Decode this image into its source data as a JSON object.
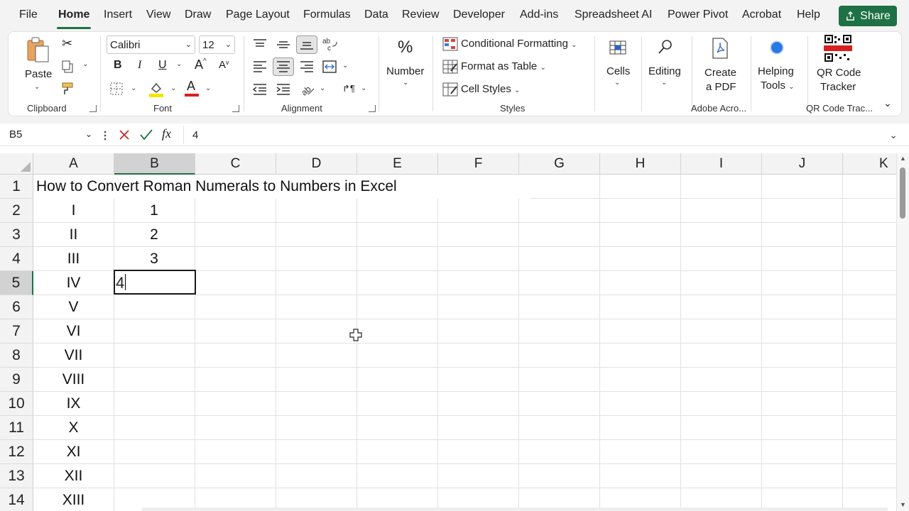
{
  "menu": {
    "items": [
      "File",
      "Home",
      "Insert",
      "View",
      "Draw",
      "Page Layout",
      "Formulas",
      "Data",
      "Review",
      "Developer",
      "Add-ins",
      "Spreadsheet AI",
      "Power Pivot",
      "Acrobat",
      "Help"
    ],
    "active": "Home",
    "share_label": "Share"
  },
  "ribbon": {
    "clipboard": {
      "paste_label": "Paste",
      "group_label": "Clipboard"
    },
    "font": {
      "font_name": "Calibri",
      "font_size": "12",
      "bold": "B",
      "italic": "I",
      "underline": "U",
      "grow": "A",
      "shrink": "A",
      "font_color_letter": "A",
      "group_label": "Font"
    },
    "alignment": {
      "group_label": "Alignment"
    },
    "number": {
      "label": "Number",
      "symbol": "%"
    },
    "styles": {
      "conditional": "Conditional Formatting",
      "format_table": "Format as Table",
      "cell_styles": "Cell Styles",
      "group_label": "Styles"
    },
    "cells": {
      "label": "Cells"
    },
    "editing": {
      "label": "Editing"
    },
    "adobe": {
      "line1": "Create",
      "line2": "a PDF",
      "group_label": "Adobe Acro..."
    },
    "helping": {
      "line1": "Helping",
      "line2": "Tools"
    },
    "qr": {
      "line1": "QR Code",
      "line2": "Tracker",
      "group_label": "QR Code Trac..."
    }
  },
  "formula_bar": {
    "name_box": "B5",
    "fx": "fx",
    "value": "4"
  },
  "columns": [
    "A",
    "B",
    "C",
    "D",
    "E",
    "F",
    "G",
    "H",
    "I",
    "J",
    "K"
  ],
  "selected_column": "B",
  "rows": [
    "1",
    "2",
    "3",
    "4",
    "5",
    "6",
    "7",
    "8",
    "9",
    "10",
    "11",
    "12",
    "13",
    "14"
  ],
  "selected_row": "5",
  "sheet": {
    "title": "How to Convert Roman Numerals to Numbers in Excel",
    "col_a": [
      "I",
      "II",
      "III",
      "IV",
      "V",
      "VI",
      "VII",
      "VIII",
      "IX",
      "X",
      "XI",
      "XII",
      "XIII"
    ],
    "col_b": [
      "1",
      "2",
      "3"
    ],
    "active_cell_value": "4"
  },
  "colors": {
    "accent": "#1e7145",
    "ribbon_bg": "#f3f3f3",
    "grid_line": "#e1e1e1"
  }
}
